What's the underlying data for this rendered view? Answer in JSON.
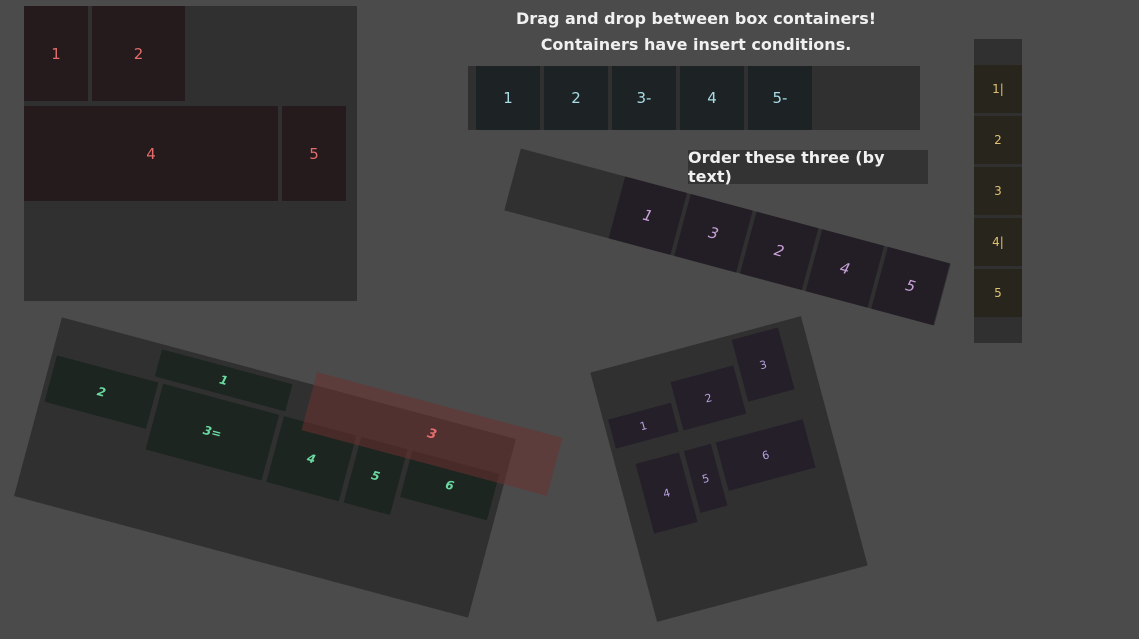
{
  "instructions": {
    "line1": "Drag and drop between box containers!",
    "line2": "Containers have insert conditions."
  },
  "order_button": {
    "label": "Order these three (by text)"
  },
  "grid_container": {
    "boxes": [
      "1",
      "2",
      "4",
      "5"
    ]
  },
  "row_container": {
    "boxes": [
      "1",
      "2",
      "3-",
      "4",
      "5-"
    ]
  },
  "tilted_row_container": {
    "boxes": [
      "1",
      "3",
      "2",
      "4",
      "5"
    ]
  },
  "vertical_container": {
    "boxes": [
      "1|",
      "2",
      "3",
      "4|",
      "5"
    ]
  },
  "tilted_green_container": {
    "boxes": [
      "1",
      "2",
      "3=",
      "4",
      "5",
      "6"
    ]
  },
  "dragged_box": {
    "label": "3"
  },
  "tilted_lavender_container": {
    "boxes": [
      "1",
      "2",
      "3",
      "4",
      "5",
      "6"
    ]
  },
  "colors": {
    "background": "#4b4b4b",
    "panel": "#303030",
    "red_text": "#e46c6c",
    "teal_text": "#a8dce6",
    "purple_text": "#c8a2d8",
    "yellow_text": "#e0c070",
    "green_text": "#6ad8a0",
    "lavender_text": "#b7a0dd"
  }
}
